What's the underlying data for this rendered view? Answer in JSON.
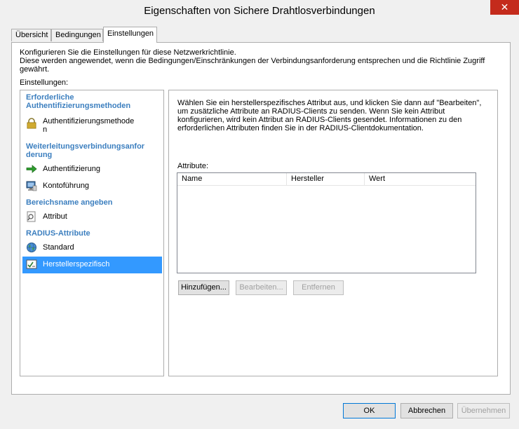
{
  "window": {
    "title": "Eigenschaften von Sichere Drahtlosverbindungen",
    "close_glyph": "✕"
  },
  "tabs": [
    {
      "label": "Übersicht"
    },
    {
      "label": "Bedingungen"
    },
    {
      "label": "Einstellungen"
    }
  ],
  "intro": {
    "line1": "Konfigurieren Sie die Einstellungen für diese Netzwerkrichtlinie.",
    "line2": "Diese werden angewendet, wenn die Bedingungen/Einschränkungen der Verbindungsanforderung entsprechen und die Richtlinie Zugriff gewährt."
  },
  "settings_label": "Einstellungen:",
  "nav": {
    "groups": [
      {
        "header_line1": "Erforderliche",
        "header_line2": "Authentifizierungsmethoden"
      },
      {
        "header_line1": "Weiterleitungsverbindungsanfor",
        "header_line2": "derung"
      },
      {
        "header_line1": "Bereichsname angeben"
      },
      {
        "header_line1": "RADIUS-Attribute"
      }
    ],
    "items": [
      {
        "label_line1": "Authentifizierungsmethode",
        "label_line2": "n",
        "icon": "lock-icon"
      },
      {
        "label_line1": "Authentifizierung",
        "icon": "green-arrow-icon"
      },
      {
        "label_line1": "Kontoführung",
        "icon": "computer-icon"
      },
      {
        "label_line1": "Attribut",
        "icon": "search-page-icon"
      },
      {
        "label_line1": "Standard",
        "icon": "globe-icon"
      },
      {
        "label_line1": "Herstellerspezifisch",
        "icon": "checklist-icon",
        "selected": true
      }
    ]
  },
  "right": {
    "desc_line1": "Wählen Sie ein herstellerspezifisches Attribut aus, und klicken Sie dann auf \"Bearbeiten\",",
    "desc_line2": "um zusätzliche Attribute an RADIUS-Clients zu senden. Wenn Sie kein Attribut",
    "desc_line3": "konfigurieren, wird kein Attribut an RADIUS-Clients gesendet. Informationen zu den",
    "desc_line4": "erforderlichen Attributen finden Sie in der RADIUS-Clientdokumentation.",
    "attributes_label": "Attribute:",
    "columns": [
      "Name",
      "Hersteller",
      "Wert"
    ],
    "buttons": {
      "add": "Hinzufügen...",
      "edit": "Bearbeiten...",
      "remove": "Entfernen"
    }
  },
  "footer": {
    "ok": "OK",
    "cancel": "Abbrechen",
    "apply": "Übernehmen"
  },
  "colors": {
    "accent_blue": "#3399ff",
    "group_header": "#3c7fbf",
    "close_red": "#c42b1c"
  }
}
